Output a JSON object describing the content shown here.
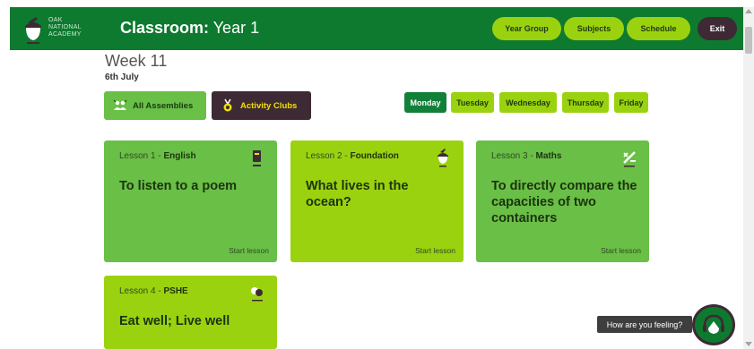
{
  "header": {
    "logo_lines": [
      "OAK",
      "NATIONAL",
      "ACADEMY"
    ],
    "title_bold": "Classroom:",
    "title_rest": " Year 1",
    "nav": {
      "year_group": "Year Group",
      "subjects": "Subjects",
      "schedule": "Schedule",
      "exit": "Exit"
    }
  },
  "week": {
    "title": "Week 11",
    "date": "6th July"
  },
  "filters": {
    "assemblies": "All Assemblies",
    "clubs": "Activity Clubs"
  },
  "days": [
    "Monday",
    "Tuesday",
    "Wednesday",
    "Thursday",
    "Friday"
  ],
  "active_day": "Monday",
  "lessons": [
    {
      "prefix": "Lesson 1 - ",
      "subject": "English",
      "title": "To listen to a poem",
      "start": "Start lesson",
      "icon": "book-icon"
    },
    {
      "prefix": "Lesson 2 - ",
      "subject": "Foundation",
      "title": "What lives in the ocean?",
      "start": "Start lesson",
      "icon": "acorn-icon"
    },
    {
      "prefix": "Lesson 3 - ",
      "subject": "Maths",
      "title": "To directly compare the capacities of two containers",
      "start": "Start lesson",
      "icon": "maths-icon"
    },
    {
      "prefix": "Lesson 4 - ",
      "subject": "PSHE",
      "title": "Eat well; Live well",
      "start": "",
      "icon": "pshe-icon"
    }
  ],
  "feelings": {
    "label": "How are you feeling?"
  },
  "colors": {
    "header_green": "#0d7a2f",
    "lime": "#9bd20f",
    "card_green": "#6abf47",
    "dark_plum": "#3e2a35",
    "active_day": "#13803a",
    "clubs_text": "#f0e000"
  }
}
